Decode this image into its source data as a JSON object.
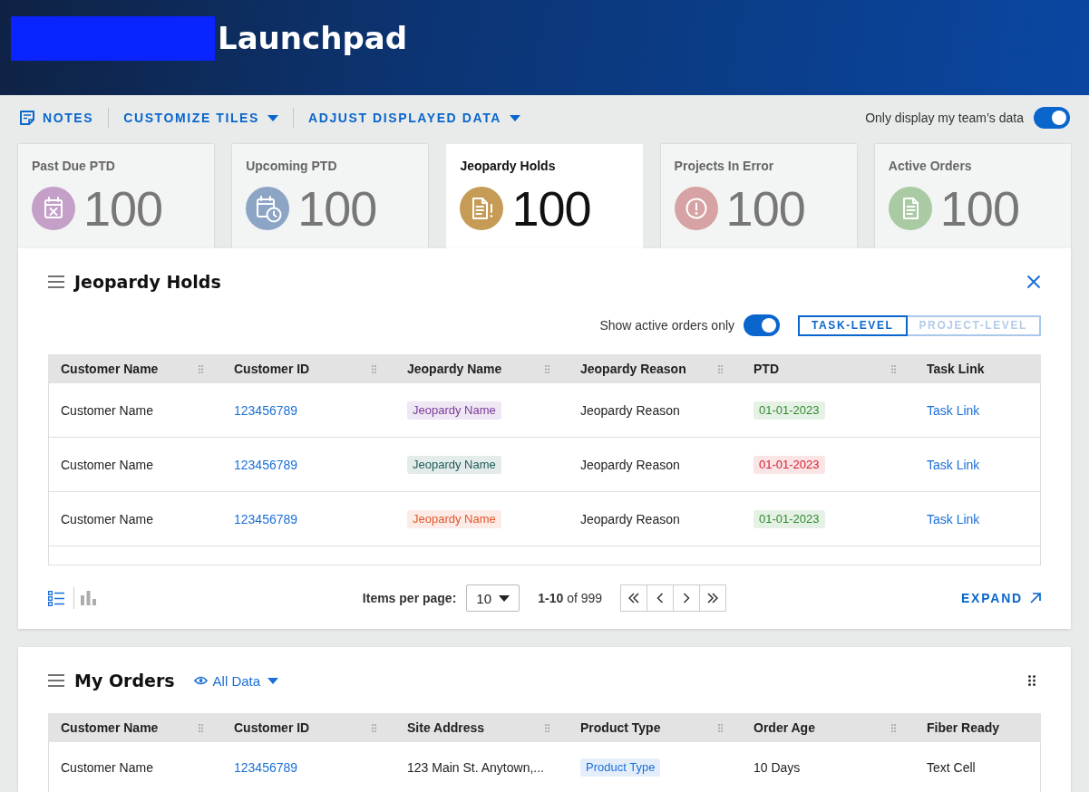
{
  "header": {
    "title": "Launchpad"
  },
  "toolbar": {
    "actions": [
      {
        "label": "NOTES",
        "kind": "notes"
      },
      {
        "label": "CUSTOMIZE TILES",
        "kind": "menu"
      },
      {
        "label": "ADJUST DISPLAYED DATA",
        "kind": "menu"
      }
    ],
    "team_filter": {
      "label": "Only display my team’s data",
      "on": true
    }
  },
  "tiles": [
    {
      "title": "Past Due PTD",
      "count": "100",
      "kind": "overdue",
      "color": "#c49fc8",
      "selected": false
    },
    {
      "title": "Upcoming PTD",
      "count": "100",
      "kind": "upcoming",
      "color": "#8ca5c5",
      "selected": false
    },
    {
      "title": "Jeopardy Holds",
      "count": "100",
      "kind": "hold",
      "color": "#c59b56",
      "selected": true
    },
    {
      "title": "Projects In Error",
      "count": "100",
      "kind": "error",
      "color": "#d6a2a3",
      "selected": false
    },
    {
      "title": "Active Orders",
      "count": "100",
      "kind": "orders",
      "color": "#a9caa3",
      "selected": false
    }
  ],
  "jeopardy_panel": {
    "title": "Jeopardy Holds",
    "active_filter": {
      "label": "Show active orders only",
      "on": true
    },
    "levels": [
      {
        "label": "TASK-LEVEL",
        "selected": true
      },
      {
        "label": "PROJECT-LEVEL",
        "selected": false
      }
    ],
    "table": {
      "columns": [
        "Customer Name",
        "Customer ID",
        "Jeopardy Name",
        "Jeopardy Reason",
        "PTD",
        "Task Link"
      ],
      "rows": [
        {
          "cells": [
            {
              "kind": "text",
              "text": "Customer Name"
            },
            {
              "kind": "link",
              "text": "123456789"
            },
            {
              "kind": "tag",
              "text": "Jeopardy Name",
              "color": "#7a3b9b"
            },
            {
              "kind": "text",
              "text": "Jeopardy Reason"
            },
            {
              "kind": "tag",
              "text": "01-01-2023",
              "color": "#2e8b2e"
            },
            {
              "kind": "link",
              "text": "Task Link"
            }
          ]
        },
        {
          "cells": [
            {
              "kind": "text",
              "text": "Customer Name"
            },
            {
              "kind": "link",
              "text": "123456789"
            },
            {
              "kind": "tag",
              "text": "Jeopardy Name",
              "color": "#1d5c57"
            },
            {
              "kind": "text",
              "text": "Jeopardy Reason"
            },
            {
              "kind": "tag",
              "text": "01-01-2023",
              "color": "#d4202f"
            },
            {
              "kind": "link",
              "text": "Task Link"
            }
          ]
        },
        {
          "cells": [
            {
              "kind": "text",
              "text": "Customer Name"
            },
            {
              "kind": "link",
              "text": "123456789"
            },
            {
              "kind": "tag",
              "text": "Jeopardy Name",
              "color": "#e3582b"
            },
            {
              "kind": "text",
              "text": "Jeopardy Reason"
            },
            {
              "kind": "tag",
              "text": "01-01-2023",
              "color": "#2e8b2e"
            },
            {
              "kind": "link",
              "text": "Task Link"
            }
          ]
        }
      ]
    },
    "views": [
      {
        "kind": "list",
        "selected": true
      },
      {
        "kind": "chart",
        "selected": false
      }
    ],
    "pagination": {
      "items_per_page_label": "Items per page:",
      "page_size": "10",
      "range": "**1-10** of 999"
    },
    "expand_label": "EXPAND"
  },
  "orders_panel": {
    "title": "My Orders",
    "data_filter": "All Data",
    "table": {
      "columns": [
        "Customer Name",
        "Customer ID",
        "Site Address",
        "Product Type",
        "Order Age",
        "Fiber Ready"
      ],
      "rows": [
        {
          "cells": [
            {
              "kind": "text",
              "text": "Customer Name"
            },
            {
              "kind": "link",
              "text": "123456789"
            },
            {
              "kind": "text",
              "text": "123 Main St. Anytown,..."
            },
            {
              "kind": "tag",
              "text": "Product Type",
              "color": "#1a6fd8"
            },
            {
              "kind": "text",
              "text": "10 Days"
            },
            {
              "kind": "text",
              "text": "Text Cell"
            }
          ]
        }
      ]
    }
  }
}
